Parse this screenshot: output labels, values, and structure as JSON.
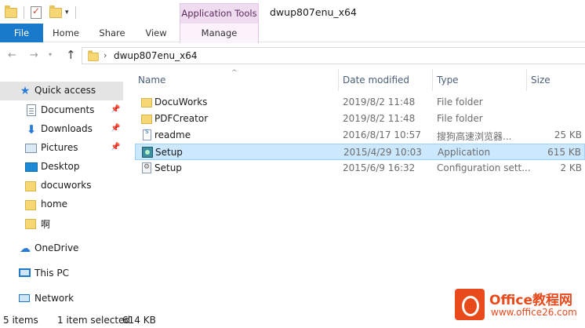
{
  "window": {
    "title": "dwup807enu_x64",
    "contextual_tab_group": "Application Tools"
  },
  "ribbon": {
    "tabs": [
      "File",
      "Home",
      "Share",
      "View",
      "Manage"
    ],
    "accent_color": "#1979ca",
    "context_color": "#f0dcf0"
  },
  "address": {
    "path": "dwup807enu_x64"
  },
  "nav": {
    "items": [
      {
        "label": "Quick access",
        "icon": "star-icon"
      },
      {
        "label": "Documents",
        "icon": "documents-icon",
        "pinned": true
      },
      {
        "label": "Downloads",
        "icon": "downloads-icon",
        "pinned": true
      },
      {
        "label": "Pictures",
        "icon": "pictures-icon",
        "pinned": true
      },
      {
        "label": "Desktop",
        "icon": "desktop-icon"
      },
      {
        "label": "docuworks",
        "icon": "folder-icon"
      },
      {
        "label": "home",
        "icon": "folder-icon"
      },
      {
        "label": "啊",
        "icon": "folder-icon"
      },
      {
        "label": "OneDrive",
        "icon": "cloud-icon"
      },
      {
        "label": "This PC",
        "icon": "computer-icon"
      },
      {
        "label": "Network",
        "icon": "network-icon"
      }
    ]
  },
  "columns": [
    "Name",
    "Date modified",
    "Type",
    "Size"
  ],
  "files": [
    {
      "name": "DocuWorks",
      "date": "2019/8/2 11:48",
      "type": "File folder",
      "size": "",
      "icon": "folder-icon"
    },
    {
      "name": "PDFCreator",
      "date": "2019/8/2 11:48",
      "type": "File folder",
      "size": "",
      "icon": "folder-icon"
    },
    {
      "name": "readme",
      "date": "2016/8/17 10:57",
      "type": "搜狗高速浏览器...",
      "size": "25 KB",
      "icon": "html-file-icon"
    },
    {
      "name": "Setup",
      "date": "2015/4/29 10:03",
      "type": "Application",
      "size": "615 KB",
      "icon": "setup-exe-icon",
      "selected": true
    },
    {
      "name": "Setup",
      "date": "2015/6/9 16:32",
      "type": "Configuration sett...",
      "size": "2 KB",
      "icon": "config-file-icon"
    }
  ],
  "status": {
    "items": "5 items",
    "selected": "1 item selected",
    "selected_size": "614 KB"
  },
  "watermark": {
    "title": "Office教程网",
    "url": "www.office26.com"
  }
}
